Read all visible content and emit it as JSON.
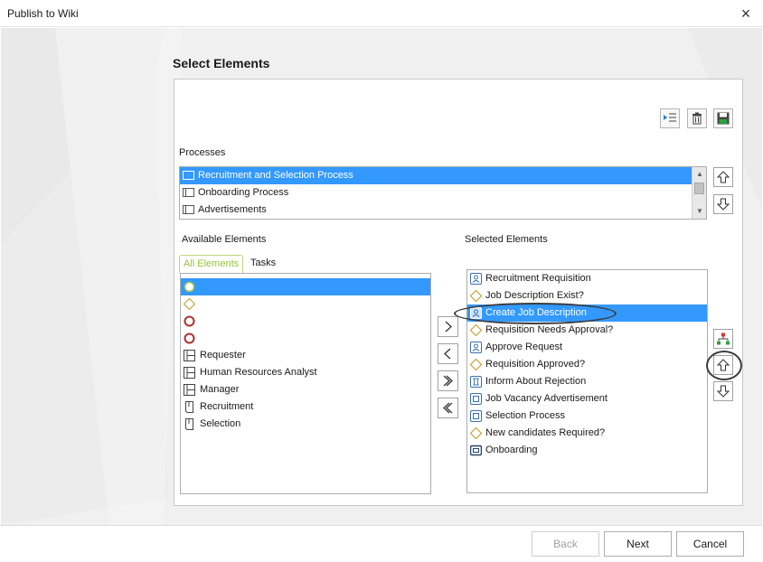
{
  "window": {
    "title": "Publish to Wiki",
    "close_icon": "×"
  },
  "heading": "Select Elements",
  "toolbar": {
    "indent_icon": "indent-icon",
    "delete_icon": "trash-icon",
    "save_icon": "save-icon"
  },
  "processes": {
    "label": "Processes",
    "items": [
      {
        "label": "Recruitment and Selection Process",
        "selected": true
      },
      {
        "label": "Onboarding Process",
        "selected": false
      },
      {
        "label": "Advertisements",
        "selected": false
      }
    ],
    "scroll_up": "▲",
    "scroll_down": "▼"
  },
  "available": {
    "label": "Available Elements",
    "tabs": [
      {
        "label": "All Elements",
        "active": true
      },
      {
        "label": "Tasks",
        "active": false
      }
    ],
    "items": [
      {
        "label": "",
        "icon": "start-event-icon",
        "selected": true
      },
      {
        "label": "",
        "icon": "gateway-icon",
        "selected": false
      },
      {
        "label": "",
        "icon": "end-event-icon",
        "selected": false
      },
      {
        "label": "",
        "icon": "end-event-icon",
        "selected": false
      },
      {
        "label": "Requester",
        "icon": "lane-icon",
        "selected": false
      },
      {
        "label": " Human Resources Analyst",
        "icon": "lane-icon",
        "selected": false
      },
      {
        "label": "Manager",
        "icon": "lane-icon",
        "selected": false
      },
      {
        "label": "Recruitment",
        "icon": "document-icon",
        "selected": false
      },
      {
        "label": "Selection",
        "icon": "document-icon",
        "selected": false
      }
    ]
  },
  "transfer": {
    "add_icon": "chevron-right-icon",
    "remove_icon": "chevron-left-icon",
    "add_all_icon": "double-chevron-right-icon",
    "remove_all_icon": "double-chevron-left-icon"
  },
  "selected": {
    "label": "Selected Elements",
    "items": [
      {
        "label": "Recruitment Requisition",
        "icon": "user-task-icon",
        "selected": false
      },
      {
        "label": "Job Description  Exist?",
        "icon": "gateway-icon",
        "selected": false
      },
      {
        "label": "Create Job Description",
        "icon": "user-task-icon",
        "selected": true
      },
      {
        "label": "Requisition Needs Approval?",
        "icon": "gateway-icon",
        "selected": false
      },
      {
        "label": "Approve Request",
        "icon": "user-task-icon",
        "selected": false
      },
      {
        "label": "Requisition Approved?",
        "icon": "gateway-icon",
        "selected": false
      },
      {
        "label": "Inform About Rejection",
        "icon": "script-task-icon",
        "selected": false
      },
      {
        "label": "Job Vacancy Advertisement",
        "icon": "subprocess-icon",
        "selected": false
      },
      {
        "label": "Selection Process",
        "icon": "subprocess-icon",
        "selected": false
      },
      {
        "label": " New candidates Required?",
        "icon": "gateway-icon",
        "selected": false
      },
      {
        "label": "Onboarding",
        "icon": "call-activity-icon",
        "selected": false
      }
    ]
  },
  "footer": {
    "back": "Back",
    "next": "Next",
    "cancel": "Cancel"
  },
  "colors": {
    "selection": "#3399ff",
    "tab_accent": "#9ac23c",
    "gateway": "#c8a23c",
    "end_event": "#a83232"
  }
}
